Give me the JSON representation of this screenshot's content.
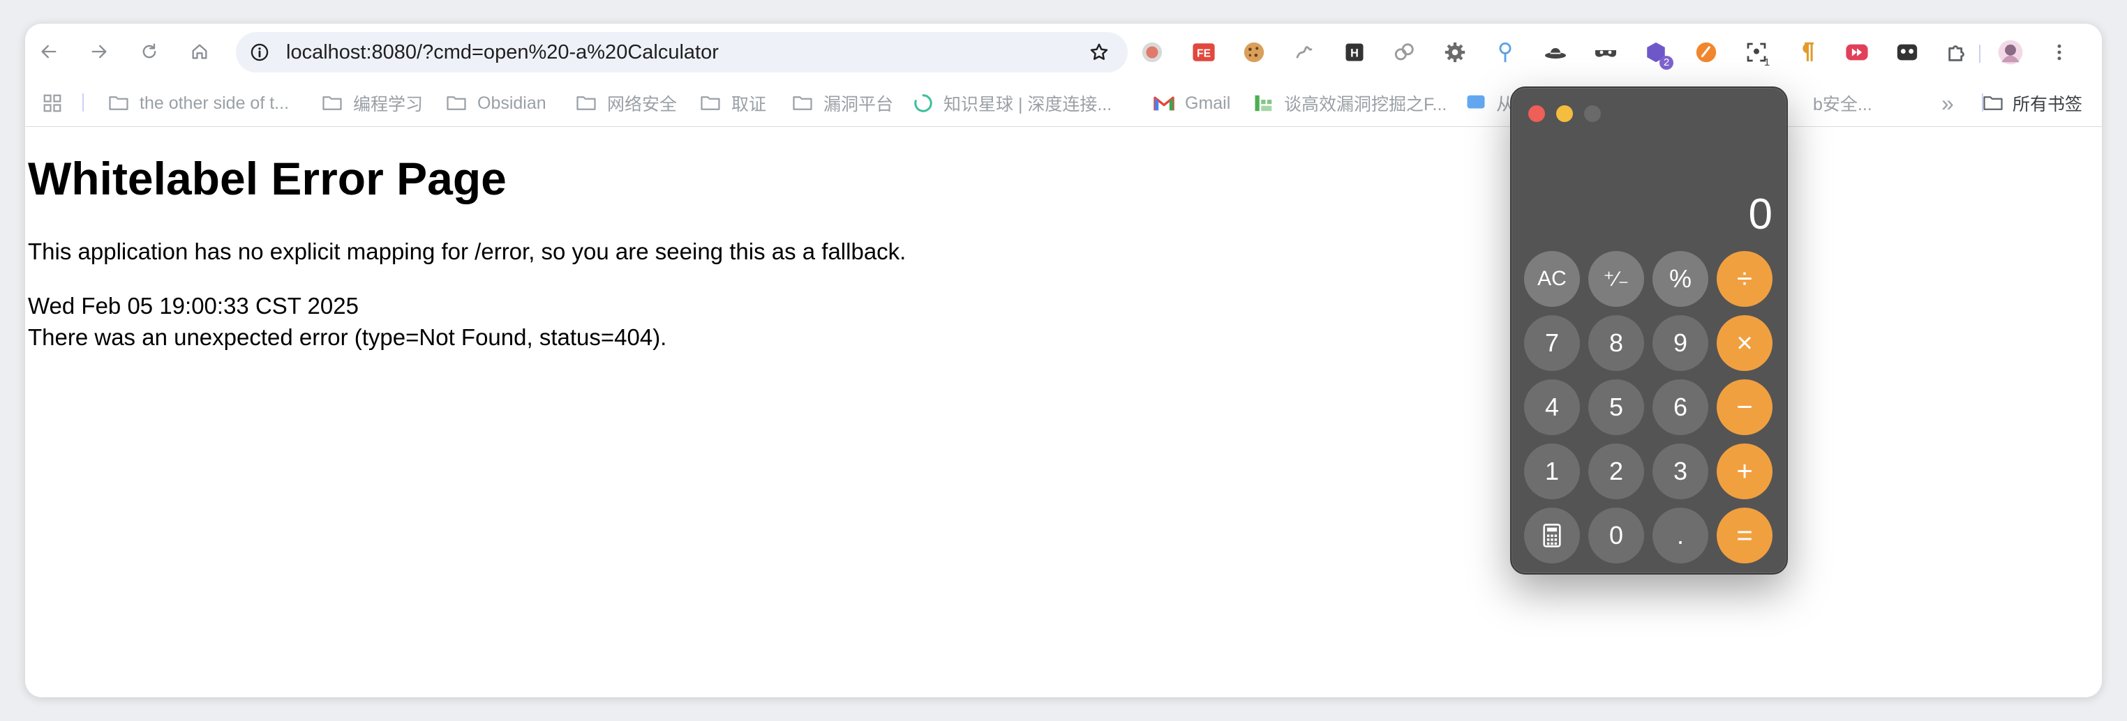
{
  "browser": {
    "url": "localhost:8080/?cmd=open%20-a%20Calculator",
    "extensions": [
      {
        "name": "record-icon",
        "color": "#b0b0b0"
      },
      {
        "name": "fe-icon",
        "color": "#e1483e",
        "text": "FE"
      },
      {
        "name": "cookie-icon",
        "color": "#c68b3c"
      },
      {
        "name": "sketch-icon",
        "color": "#9b9b9b"
      },
      {
        "name": "h-icon",
        "color": "#333333",
        "text": "H"
      },
      {
        "name": "link-icon",
        "color": "#9a9a9a"
      },
      {
        "name": "gear-icon",
        "color": "#6b6b6b"
      },
      {
        "name": "pin-icon",
        "color": "#5aa0e6"
      },
      {
        "name": "hat-icon",
        "color": "#444444"
      },
      {
        "name": "mask-icon",
        "color": "#444444"
      },
      {
        "name": "hexagon-icon",
        "color": "#6e58c9",
        "badge": "2"
      },
      {
        "name": "orange-icon",
        "color": "#f1862e"
      },
      {
        "name": "scan-icon",
        "color": "#444444",
        "badge": "1"
      },
      {
        "name": "pilcrow-icon",
        "color": "#e09b2d"
      },
      {
        "name": "forward-icon",
        "color": "#e2405a"
      },
      {
        "name": "ghost-icon",
        "color": "#333333"
      },
      {
        "name": "puzzle-icon",
        "color": "#5f6368"
      }
    ]
  },
  "bookmarks": {
    "items": [
      {
        "label": "the other side of t..."
      },
      {
        "label": "编程学习"
      },
      {
        "label": "Obsidian"
      },
      {
        "label": "网络安全"
      },
      {
        "label": "取证"
      },
      {
        "label": "漏洞平台"
      },
      {
        "label": "知识星球 | 深度连接..."
      },
      {
        "label": "Gmail"
      },
      {
        "label": "谈高效漏洞挖掘之F..."
      },
      {
        "label": "从0到"
      },
      {
        "label": "b安全..."
      }
    ],
    "overflow": "»",
    "all_bookmarks": "所有书签"
  },
  "page": {
    "title": "Whitelabel Error Page",
    "message": "This application has no explicit mapping for /error, so you are seeing this as a fallback.",
    "timestamp": "Wed Feb 05 19:00:33 CST 2025",
    "error": "There was an unexpected error (type=Not Found, status=404)."
  },
  "calculator": {
    "display": "0",
    "keys": {
      "ac": "AC",
      "sign": "⁺∕₋",
      "percent": "%",
      "divide": "÷",
      "seven": "7",
      "eight": "8",
      "nine": "9",
      "multiply": "×",
      "four": "4",
      "five": "5",
      "six": "6",
      "minus": "−",
      "one": "1",
      "two": "2",
      "three": "3",
      "plus": "+",
      "zero": "0",
      "decimal": ".",
      "equals": "="
    },
    "colors": {
      "body": "#545454",
      "operator": "#f1a040",
      "function": "#7d7d7d",
      "number": "#6e6e6e"
    }
  }
}
